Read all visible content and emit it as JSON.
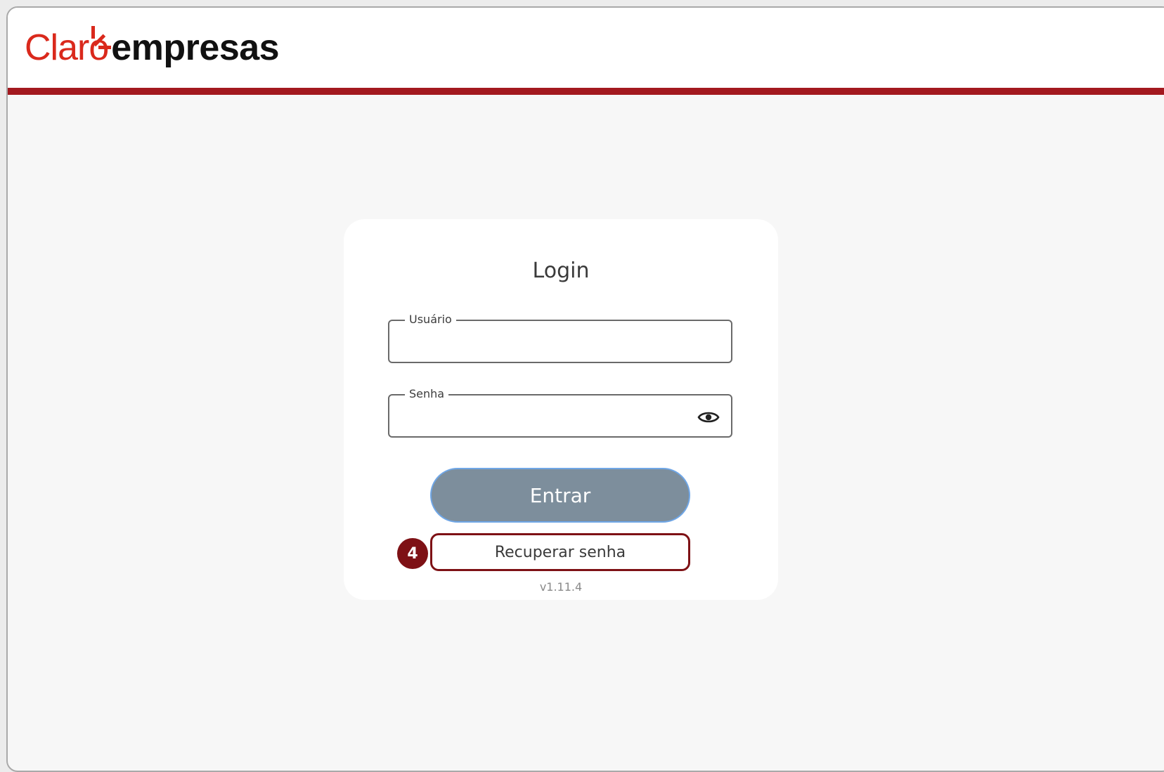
{
  "header": {
    "logo_brand": "Claro",
    "logo_product": "empresas",
    "brand_color": "#da291c",
    "bar_color": "#a3191f"
  },
  "login": {
    "title": "Login",
    "username_label": "Usuário",
    "username_value": "",
    "password_label": "Senha",
    "password_value": "",
    "toggle_icon": "eye-icon",
    "submit_label": "Entrar",
    "recover_label": "Recuperar senha",
    "step_number": "4",
    "version": "v1.11.4"
  },
  "colors": {
    "submit_bg": "#7d8e9c",
    "highlight": "#7e1115"
  }
}
